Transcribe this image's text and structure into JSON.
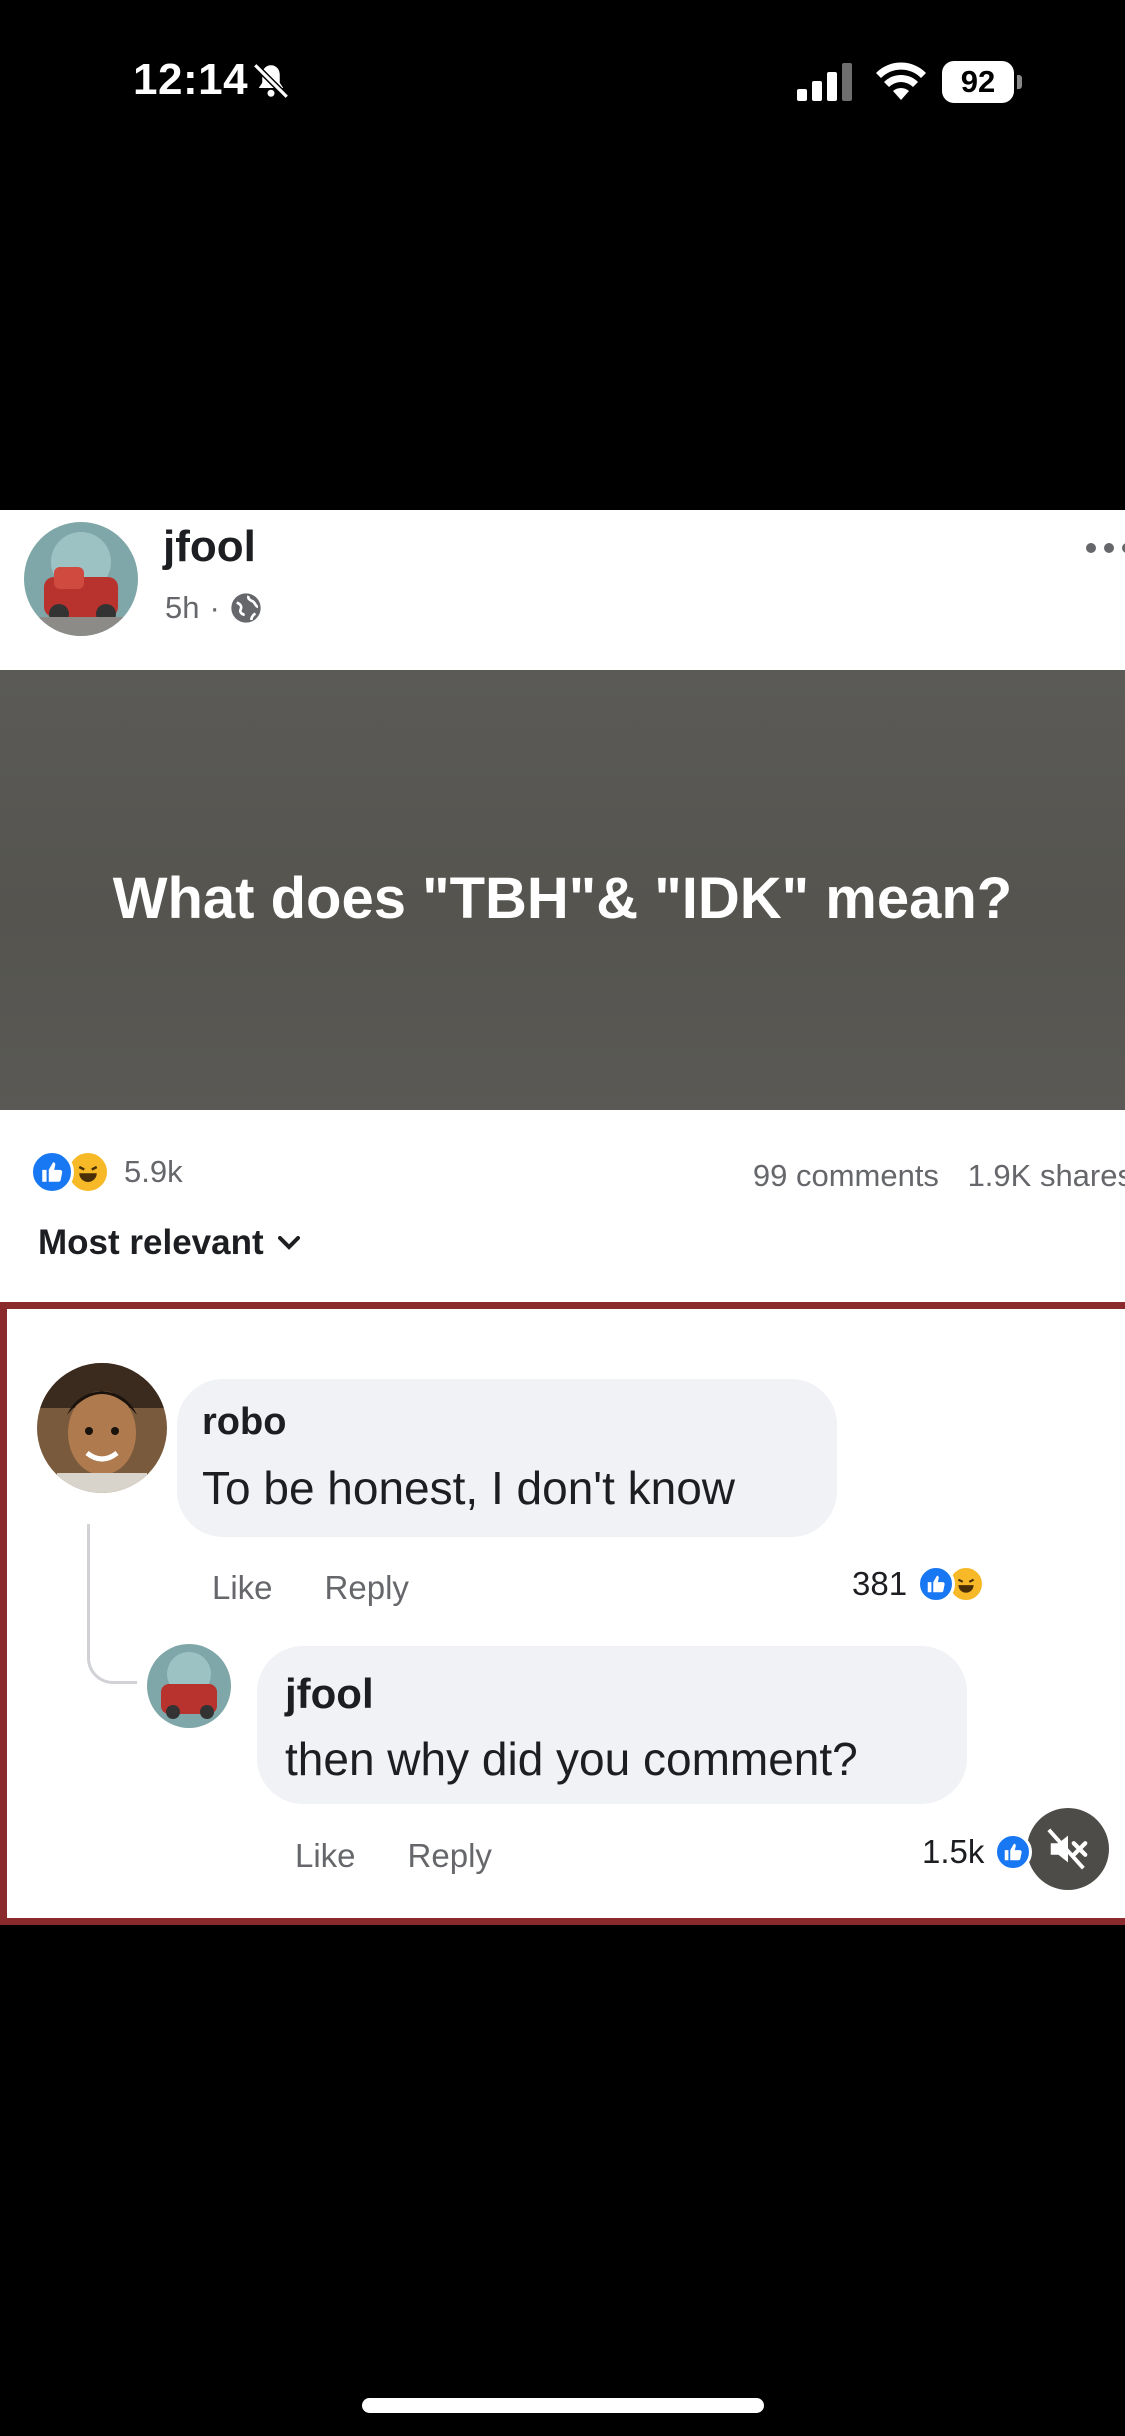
{
  "status_bar": {
    "time": "12:14",
    "battery": "92",
    "icons": [
      "bell-slash-icon",
      "signal-icon",
      "wifi-icon",
      "battery-icon"
    ]
  },
  "post": {
    "author": "jfool",
    "time": "5h",
    "meta_separator": "·",
    "banner_text": "What does \"TBH\"& \"IDK\" mean?",
    "reaction_count": "5.9k",
    "comments": "99 comments",
    "shares": "1.9K shares",
    "sort_label": "Most relevant"
  },
  "comments": [
    {
      "author": "robo",
      "text": "To be honest, I don't know",
      "like_label": "Like",
      "reply_label": "Reply",
      "reaction_count": "381"
    },
    {
      "author": "jfool",
      "text": "then why did you comment?",
      "like_label": "Like",
      "reply_label": "Reply",
      "reaction_count": "1.5k"
    }
  ],
  "colors": {
    "facebook_blue": "#1877f2",
    "haha_yellow": "#f7b928",
    "frame_red": "#8b2a2c",
    "banner_gray": "#5b5a57",
    "secondary_text": "#65676b"
  }
}
